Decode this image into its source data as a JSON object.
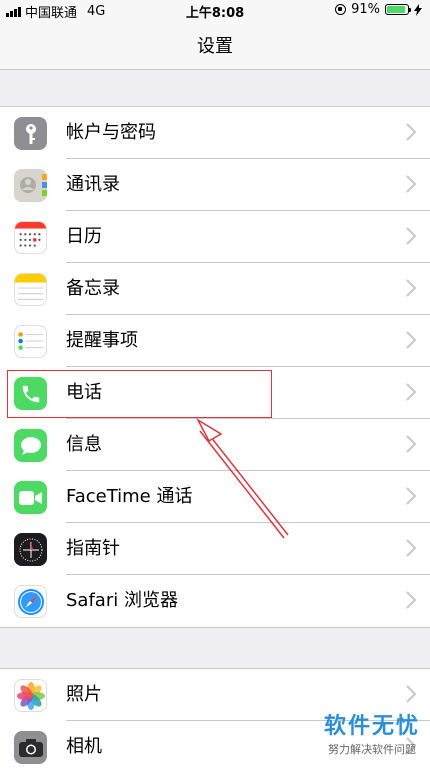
{
  "status": {
    "carrier": "中国联通",
    "network": "4G",
    "time": "上午8:08",
    "battery_pct_text": "91%",
    "battery_level": 0.91
  },
  "nav": {
    "title": "设置"
  },
  "groups": [
    {
      "items": [
        {
          "label": "帐户与密码",
          "icon": "key-icon"
        },
        {
          "label": "通讯录",
          "icon": "contacts-icon"
        },
        {
          "label": "日历",
          "icon": "calendar-icon"
        },
        {
          "label": "备忘录",
          "icon": "notes-icon"
        },
        {
          "label": "提醒事项",
          "icon": "reminders-icon"
        },
        {
          "label": "电话",
          "icon": "phone-icon"
        },
        {
          "label": "信息",
          "icon": "messages-icon"
        },
        {
          "label": "FaceTime 通话",
          "icon": "facetime-icon"
        },
        {
          "label": "指南针",
          "icon": "compass-icon"
        },
        {
          "label": "Safari 浏览器",
          "icon": "safari-icon"
        }
      ]
    },
    {
      "items": [
        {
          "label": "照片",
          "icon": "photos-icon"
        },
        {
          "label": "相机",
          "icon": "camera-icon"
        }
      ]
    }
  ],
  "colors": {
    "accent_green": "#4cd964",
    "annotation_red": "#d9363e",
    "watermark_blue": "#2b8fd8"
  },
  "watermark": {
    "title": "软件无忧",
    "subtitle": "努力解决软件问题"
  }
}
